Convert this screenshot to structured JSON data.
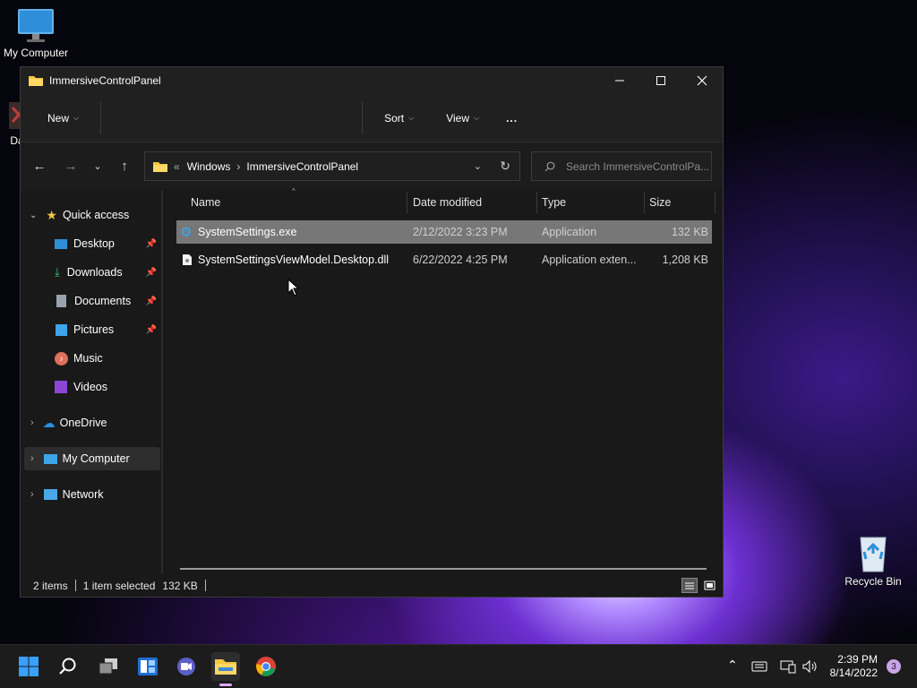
{
  "desktop": {
    "icons": [
      {
        "label": "My Computer",
        "icon": "monitor-icon"
      },
      {
        "label": "Data",
        "icon": "file-icon"
      },
      {
        "label": "Recycle Bin",
        "icon": "recycle-bin-icon"
      }
    ]
  },
  "window": {
    "title": "ImmersiveControlPanel",
    "controls": [
      "minimize",
      "maximize",
      "close"
    ]
  },
  "toolbar": {
    "new_label": "New",
    "sort_label": "Sort",
    "view_label": "View",
    "more_label": "..."
  },
  "address": {
    "overflow": "«",
    "crumbs": [
      "Windows",
      "ImmersiveControlPanel"
    ],
    "search_placeholder": "Search ImmersiveControlPa..."
  },
  "sidebar": {
    "quick_access": "Quick access",
    "items": [
      {
        "label": "Desktop",
        "pinned": true,
        "icon": "desktop-icon"
      },
      {
        "label": "Downloads",
        "pinned": true,
        "icon": "downloads-icon"
      },
      {
        "label": "Documents",
        "pinned": true,
        "icon": "documents-icon"
      },
      {
        "label": "Pictures",
        "pinned": true,
        "icon": "pictures-icon"
      },
      {
        "label": "Music",
        "pinned": false,
        "icon": "music-icon"
      },
      {
        "label": "Videos",
        "pinned": false,
        "icon": "videos-icon"
      }
    ],
    "onedrive": "OneDrive",
    "my_computer": "My Computer",
    "network": "Network"
  },
  "columns": {
    "name": "Name",
    "date": "Date modified",
    "type": "Type",
    "size": "Size"
  },
  "files": [
    {
      "name": "SystemSettings.exe",
      "date": "2/12/2022 3:23 PM",
      "type": "Application",
      "size": "132 KB",
      "selected": true,
      "icon": "gear-icon"
    },
    {
      "name": "SystemSettingsViewModel.Desktop.dll",
      "date": "6/22/2022 4:25 PM",
      "type": "Application exten...",
      "size": "1,208 KB",
      "selected": false,
      "icon": "dll-file-icon"
    }
  ],
  "status": {
    "count": "2 items",
    "selection": "1 item selected",
    "size": "132 KB"
  },
  "taskbar": {
    "time": "2:39 PM",
    "date": "8/14/2022",
    "notifications": "3"
  }
}
